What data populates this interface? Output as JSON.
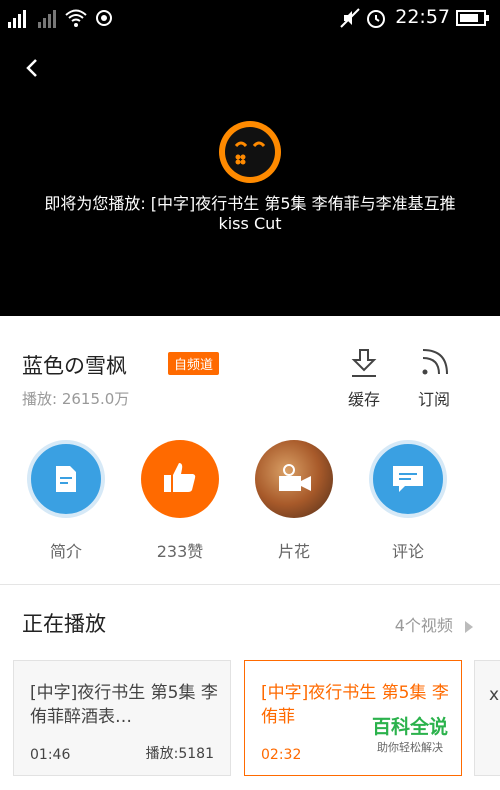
{
  "status_bar": {
    "time": "22:57"
  },
  "player": {
    "now_playing_text": "即将为您播放: [中字]夜行书生 第5集 李侑菲与李准基互推kiss Cut"
  },
  "channel": {
    "name": "蓝色の雪枫",
    "badge": "自频道",
    "plays": "播放: 2615.0万",
    "cache_label": "缓存",
    "subscribe_label": "订阅"
  },
  "circles": [
    {
      "label": "简介",
      "icon": "document-icon"
    },
    {
      "label": "233赞",
      "icon": "thumbs-up-icon"
    },
    {
      "label": "片花",
      "icon": "video-camera-icon"
    },
    {
      "label": "评论",
      "icon": "comment-icon"
    }
  ],
  "playlist": {
    "title": "正在播放",
    "count": "4个视频",
    "items": [
      {
        "title": "[中字]夜行书生 第5集 李侑菲醉酒表…",
        "duration": "01:46",
        "plays": "播放:5181",
        "active": false
      },
      {
        "title": "[中字]夜行书生 第5集 李侑菲",
        "duration": "02:32",
        "plays": "",
        "active": true
      }
    ],
    "next_peek": "x"
  },
  "watermark": {
    "main": "百科全说",
    "sub": "助你轻松解决"
  },
  "colors": {
    "accent": "#ff6a00",
    "blue": "#3aa0e2"
  }
}
